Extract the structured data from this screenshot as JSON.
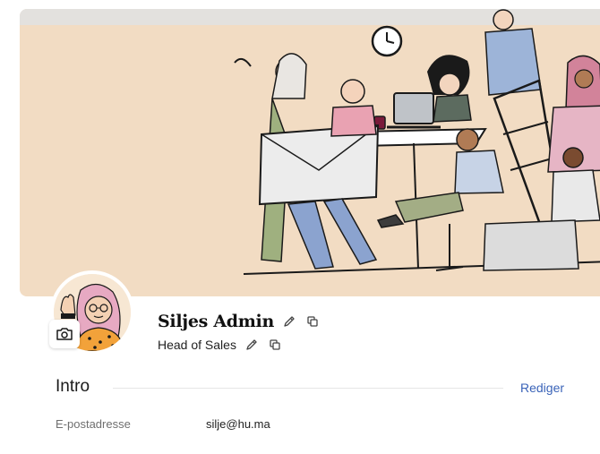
{
  "profile": {
    "name": "Siljes Admin",
    "job_title": "Head of Sales"
  },
  "intro": {
    "heading": "Intro",
    "edit_label": "Rediger",
    "fields": [
      {
        "label": "E-postadresse",
        "value": "silje@hu.ma"
      }
    ]
  },
  "icons": {
    "camera": "camera-icon",
    "edit": "pencil-icon",
    "copy": "copy-icon"
  },
  "colors": {
    "cover_background": "#f2dcc3",
    "link": "#3a63b8"
  }
}
